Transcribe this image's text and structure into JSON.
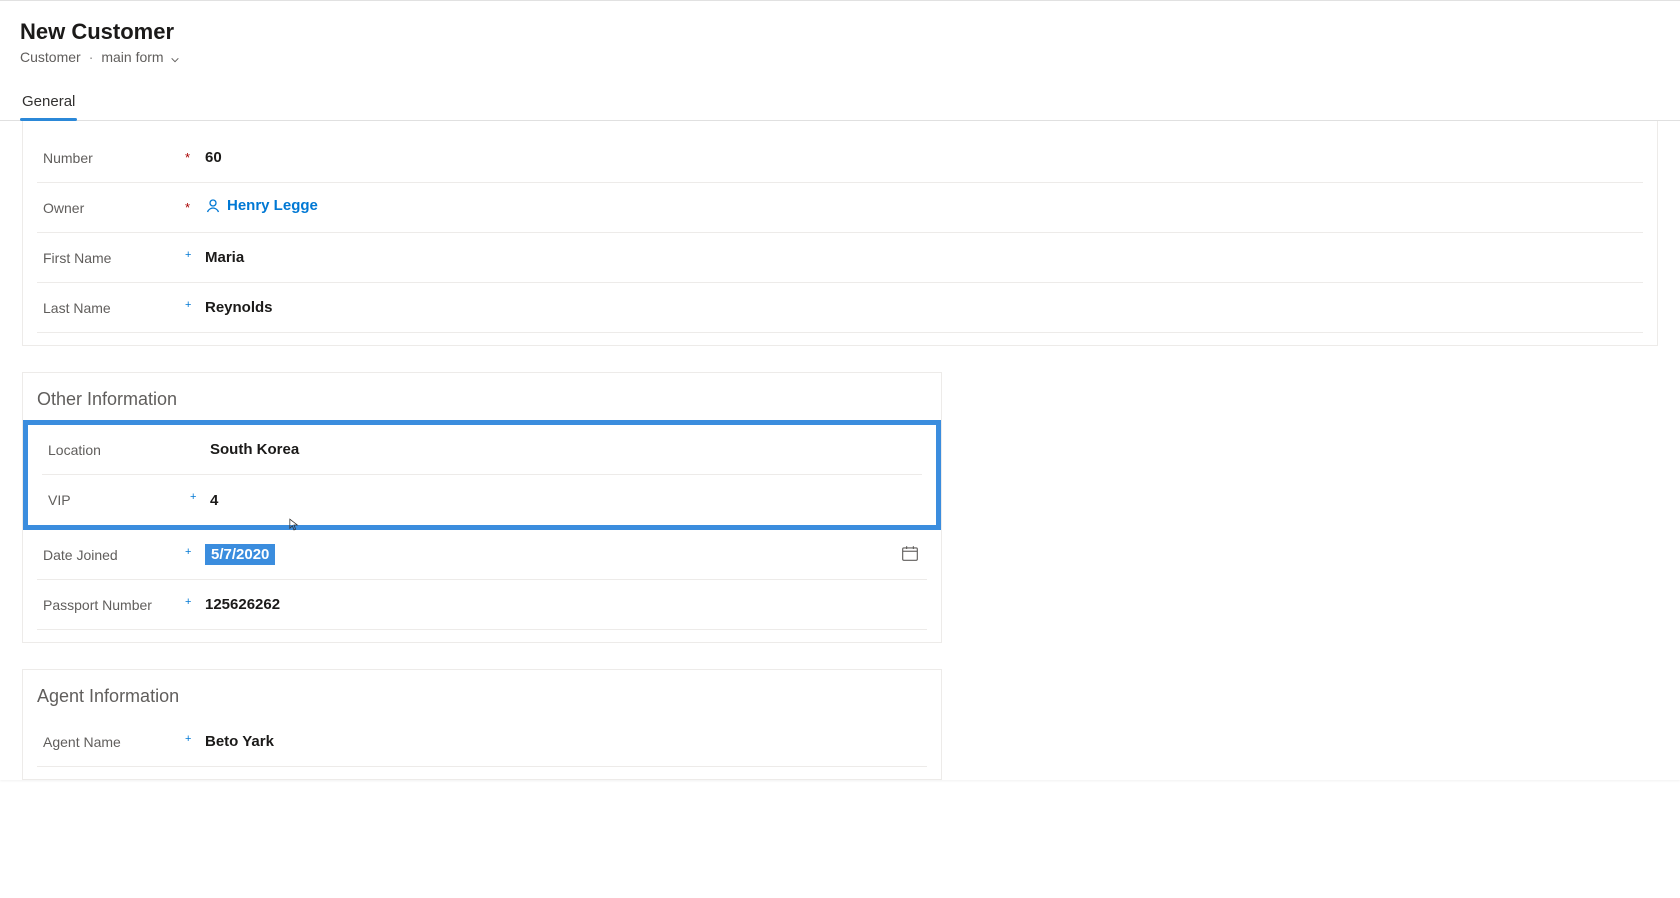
{
  "header": {
    "title": "New Customer",
    "entity": "Customer",
    "form_selector": "main form"
  },
  "tabs": [
    {
      "label": "General",
      "active": true
    }
  ],
  "sections": {
    "primary": {
      "fields": {
        "number": {
          "label": "Number",
          "indicator": "*",
          "value": "60"
        },
        "owner": {
          "label": "Owner",
          "indicator": "*",
          "value": "Henry Legge"
        },
        "first_name": {
          "label": "First Name",
          "indicator": "+",
          "value": "Maria"
        },
        "last_name": {
          "label": "Last Name",
          "indicator": "+",
          "value": "Reynolds"
        }
      }
    },
    "other": {
      "title": "Other Information",
      "fields": {
        "location": {
          "label": "Location",
          "indicator": "",
          "value": "South Korea"
        },
        "vip": {
          "label": "VIP",
          "indicator": "+",
          "value": "4"
        },
        "date_joined": {
          "label": "Date Joined",
          "indicator": "+",
          "value": "5/7/2020"
        },
        "passport": {
          "label": "Passport Number",
          "indicator": "+",
          "value": "125626262"
        }
      }
    },
    "agent": {
      "title": "Agent Information",
      "fields": {
        "agent_name": {
          "label": "Agent Name",
          "indicator": "+",
          "value": "Beto Yark"
        }
      }
    }
  }
}
